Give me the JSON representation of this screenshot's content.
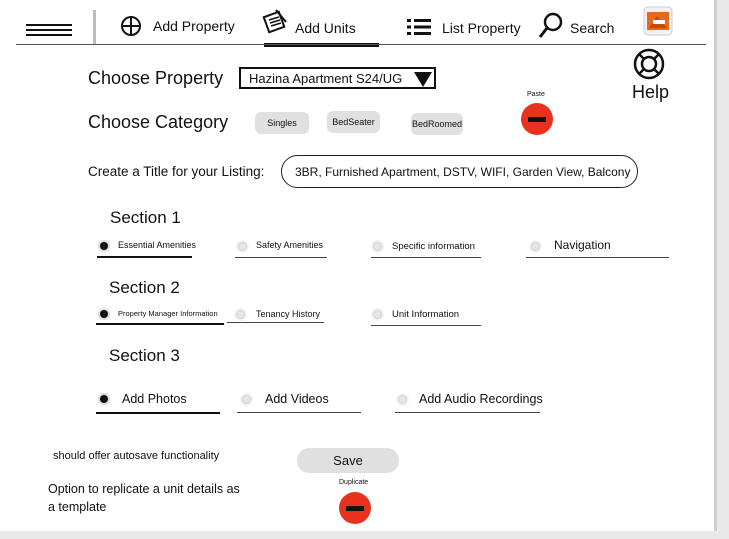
{
  "nav": {
    "add_property": "Add Property",
    "add_units": "Add Units",
    "list_property": "List Property",
    "search": "Search"
  },
  "help": {
    "label": "Help"
  },
  "property": {
    "label": "Choose Property",
    "selected": "Hazina Apartment S24/UG"
  },
  "category": {
    "label": "Choose Category",
    "options": [
      "Singles",
      "BedSeater",
      "BedRoomed"
    ]
  },
  "paste": {
    "label": "Paste"
  },
  "title_field": {
    "label": "Create a Title for your Listing:",
    "value": "3BR, Furnished Apartment, DSTV, WIFI, Garden View, Balcony"
  },
  "section1": {
    "heading": "Section 1",
    "options": [
      "Essential Amenities",
      "Safety Amenities",
      "Specific information",
      "Navigation"
    ]
  },
  "section2": {
    "heading": "Section 2",
    "options": [
      "Property Manager Information",
      "Tenancy History",
      "Unit Information"
    ]
  },
  "section3": {
    "heading": "Section 3",
    "options": [
      "Add Photos",
      "Add Videos",
      "Add Audio Recordings"
    ]
  },
  "notes": {
    "autosave": "should offer autosave functionality",
    "replicate": "Option to replicate a unit details as a template"
  },
  "save": {
    "label": "Save"
  },
  "duplicate": {
    "label": "Duplicate"
  },
  "colors": {
    "accent_red": "#e8321d",
    "chip_gray": "#e0e0e0",
    "page_bg": "#ffffff"
  }
}
